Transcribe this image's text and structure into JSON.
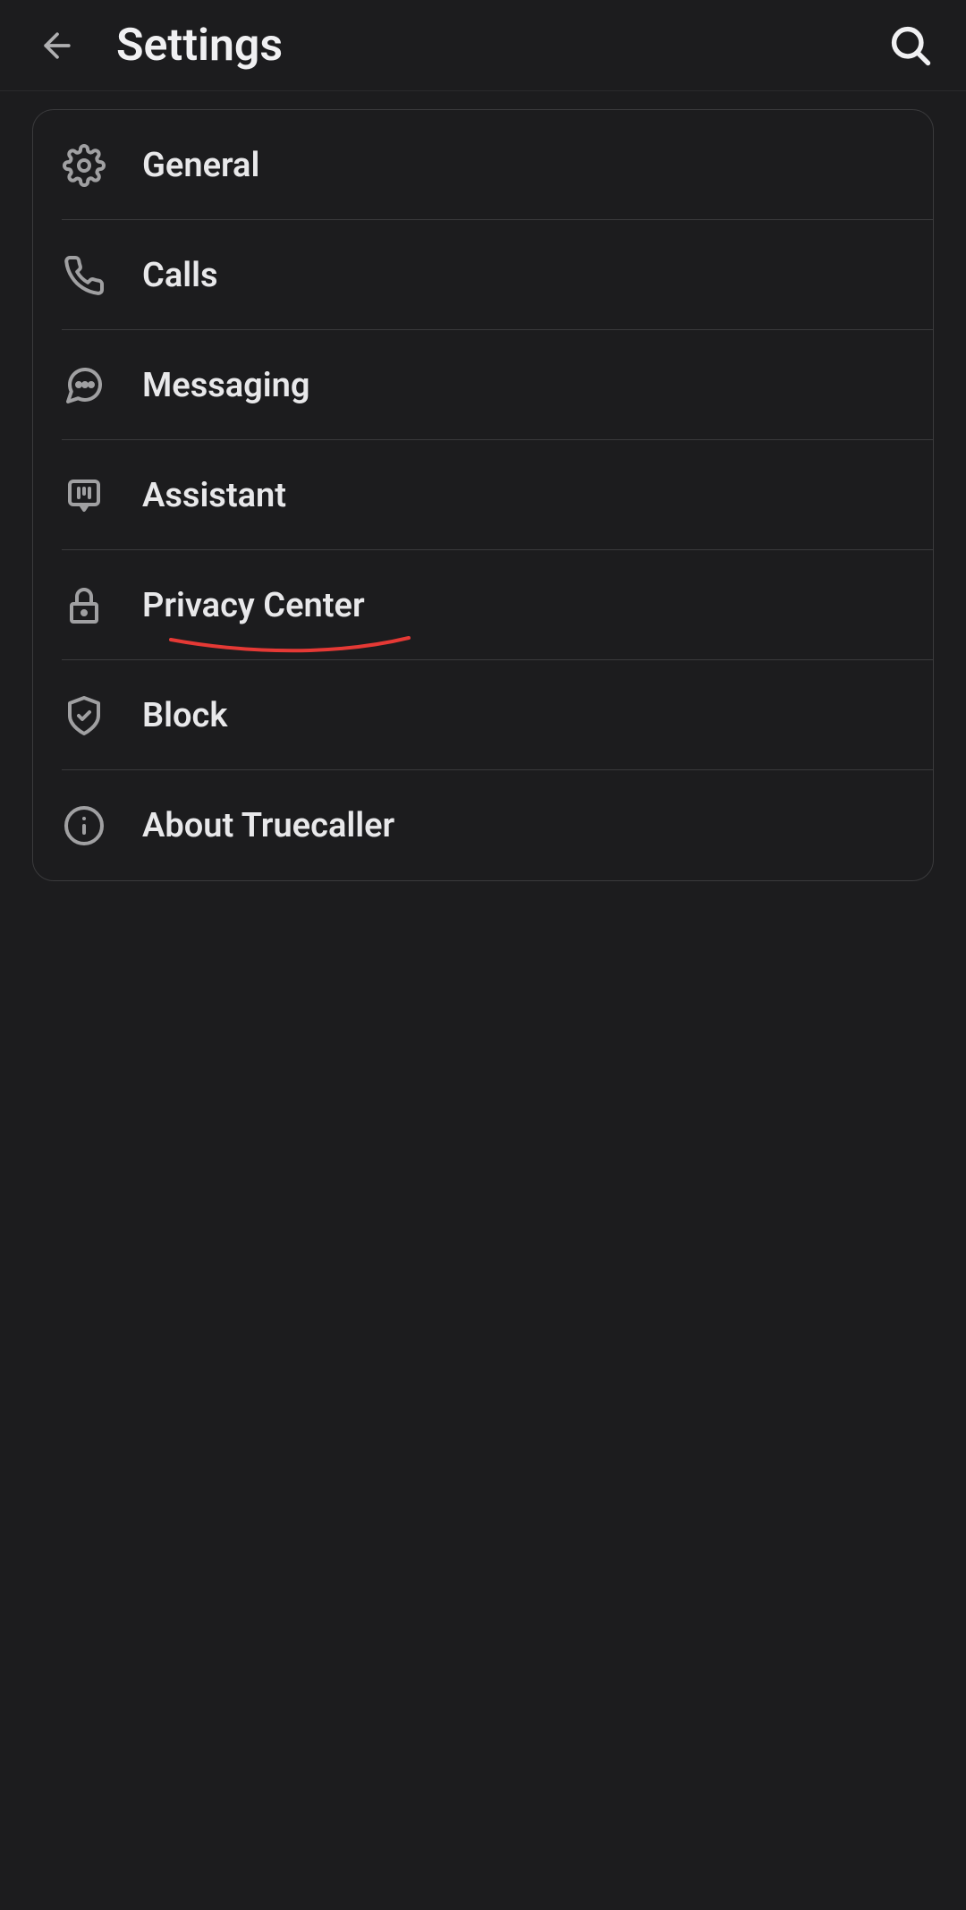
{
  "header": {
    "title": "Settings"
  },
  "settings": {
    "items": [
      {
        "label": "General",
        "icon": "gear"
      },
      {
        "label": "Calls",
        "icon": "phone"
      },
      {
        "label": "Messaging",
        "icon": "chat"
      },
      {
        "label": "Assistant",
        "icon": "assistant"
      },
      {
        "label": "Privacy Center",
        "icon": "lock",
        "annotated": true
      },
      {
        "label": "Block",
        "icon": "shield"
      },
      {
        "label": "About Truecaller",
        "icon": "info"
      }
    ]
  }
}
